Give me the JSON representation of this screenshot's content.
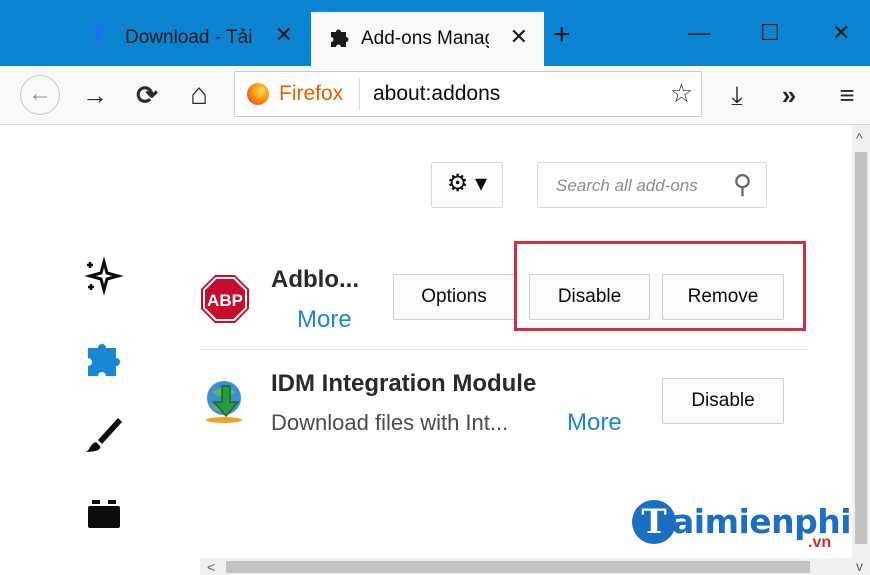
{
  "tabs": [
    {
      "title": "Download - Tải",
      "close": "✕"
    },
    {
      "title": "Add-ons Manag",
      "close": "✕"
    }
  ],
  "titlebar": {
    "new_tab": "+",
    "minimize": "—",
    "maximize": "☐",
    "close": "✕"
  },
  "nav": {
    "back": "←",
    "forward": "→",
    "reload": "⟳",
    "home": "⌂",
    "identity": "Firefox",
    "url": "about:addons",
    "bookmark": "☆",
    "downloads": "⤓",
    "overflow": "»",
    "menu": "≡"
  },
  "toolbar": {
    "gear": "⚙ ▾",
    "search_placeholder": "Search all add-ons",
    "search_icon": "⚲"
  },
  "sidebar": [
    {
      "icon": "sparkle-icon",
      "glyph": "✧"
    },
    {
      "icon": "puzzle-icon",
      "glyph": "✱"
    },
    {
      "icon": "brush-icon",
      "glyph": "✎"
    },
    {
      "icon": "plugin-icon",
      "glyph": "▬"
    }
  ],
  "addons": [
    {
      "name": "Adblo...",
      "more": "More",
      "buttons": {
        "options": "Options",
        "disable": "Disable",
        "remove": "Remove"
      },
      "icon_text": "ABP"
    },
    {
      "name": "IDM Integration Module",
      "description": "Download files with Int...",
      "more": "More",
      "buttons": {
        "disable": "Disable"
      }
    }
  ],
  "scroll": {
    "up": "^",
    "down": "v",
    "left": "<"
  },
  "watermark": {
    "logo": "T",
    "text": "aimienphi",
    "suffix": ".vn"
  },
  "colors": {
    "accent": "#0a84d0",
    "link": "#1a86d6",
    "highlight": "#d03040"
  }
}
